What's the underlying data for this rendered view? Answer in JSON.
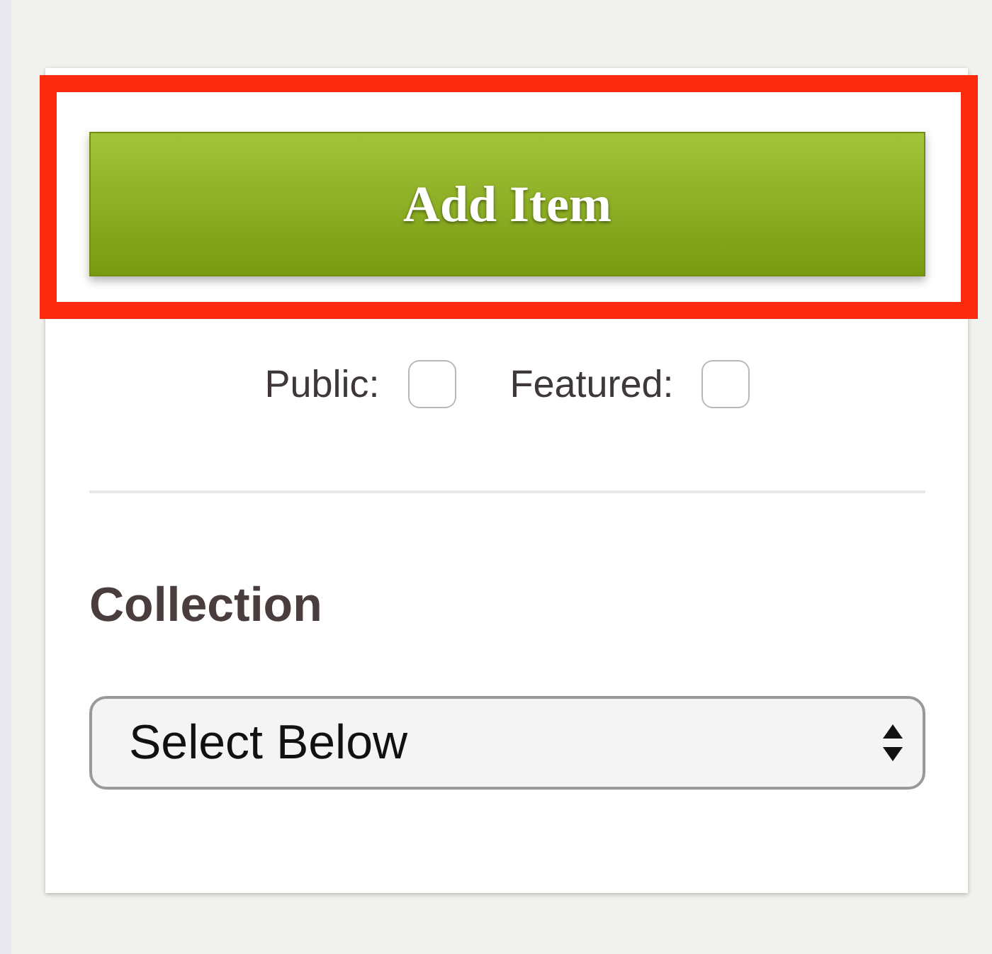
{
  "add_button": {
    "label": "Add Item",
    "highlighted": true
  },
  "options": [
    {
      "label": "Public:",
      "checked": false
    },
    {
      "label": "Featured:",
      "checked": false
    }
  ],
  "collection": {
    "heading": "Collection",
    "select": {
      "value": "Select Below"
    }
  }
}
